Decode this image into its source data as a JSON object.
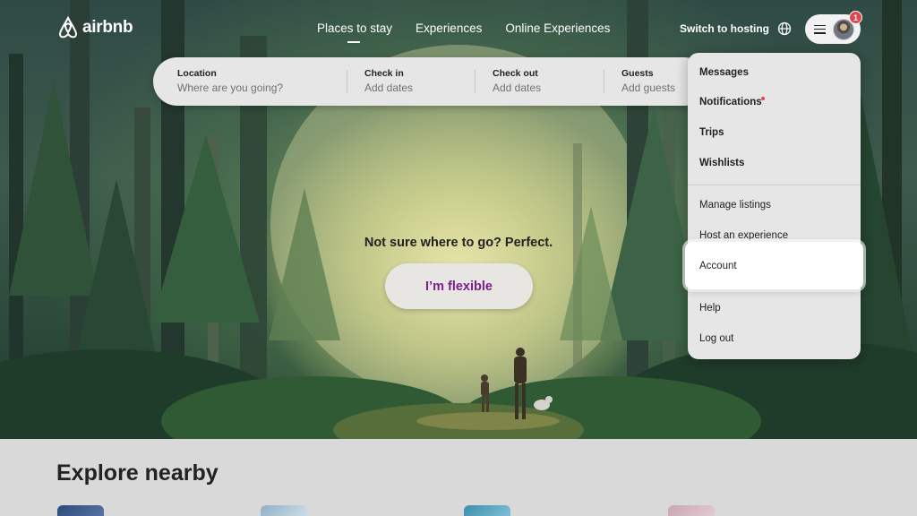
{
  "brand": {
    "name": "airbnb"
  },
  "nav": {
    "tabs": [
      {
        "label": "Places to stay",
        "active": true
      },
      {
        "label": "Experiences",
        "active": false
      },
      {
        "label": "Online Experiences",
        "active": false
      }
    ],
    "switch_to_hosting": "Switch to hosting",
    "globe_icon": "globe-icon",
    "menu_icon": "hamburger-icon",
    "notification_count": "1"
  },
  "search": {
    "fields": [
      {
        "label": "Location",
        "value": "Where are you going?"
      },
      {
        "label": "Check in",
        "value": "Add dates"
      },
      {
        "label": "Check out",
        "value": "Add dates"
      },
      {
        "label": "Guests",
        "value": "Add guests"
      }
    ]
  },
  "hero": {
    "tagline": "Not sure where to go? Perfect.",
    "button": "I’m flexible"
  },
  "user_dropdown": {
    "items": [
      {
        "label": "Messages",
        "bold": true
      },
      {
        "label": "Notifications",
        "bold": true,
        "has_dot": true
      },
      {
        "label": "Trips",
        "bold": true
      },
      {
        "label": "Wishlists",
        "bold": true
      },
      {
        "label": "Manage listings",
        "bold": false
      },
      {
        "label": "Host an experience",
        "bold": false
      },
      {
        "label": "Account",
        "bold": false,
        "highlighted": true
      },
      {
        "label": "Help",
        "bold": false
      },
      {
        "label": "Log out",
        "bold": false
      }
    ]
  },
  "explore": {
    "title": "Explore nearby"
  },
  "colors": {
    "brand_purple": "#7a1f8c",
    "badge_red": "#e0464d",
    "text_dark": "#222222"
  }
}
